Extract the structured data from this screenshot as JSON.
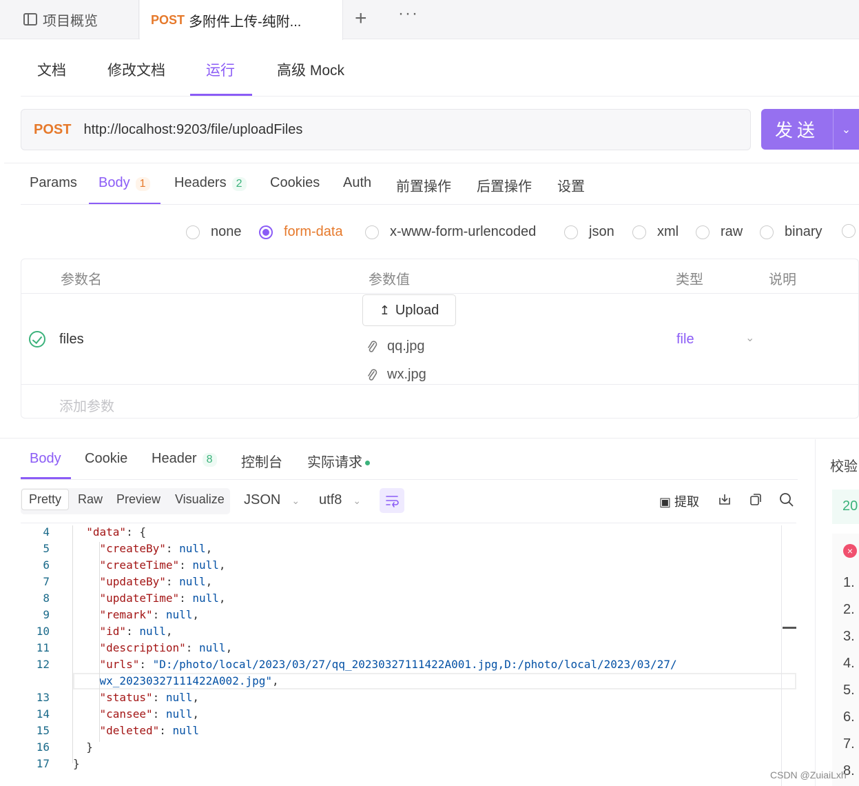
{
  "tabs": {
    "overview": "项目概览",
    "current_method": "POST",
    "current_title": "多附件上传-纯附...",
    "add": "+",
    "more": "···"
  },
  "doc_tabs": [
    "文档",
    "修改文档",
    "运行",
    "高级 Mock"
  ],
  "request": {
    "method": "POST",
    "url": "http://localhost:9203/file/uploadFiles",
    "send_label": "发送"
  },
  "req_tabs": {
    "params": "Params",
    "body": "Body",
    "body_count": "1",
    "headers": "Headers",
    "headers_count": "2",
    "cookies": "Cookies",
    "auth": "Auth",
    "pre": "前置操作",
    "post": "后置操作",
    "settings": "设置"
  },
  "body_types": [
    "none",
    "form-data",
    "x-www-form-urlencoded",
    "json",
    "xml",
    "raw",
    "binary"
  ],
  "body_type_selected": "form-data",
  "params_table": {
    "headers": [
      "参数名",
      "参数值",
      "类型",
      "说明"
    ],
    "row": {
      "name": "files",
      "upload_label": "Upload",
      "files": [
        "qq.jpg",
        "wx.jpg"
      ],
      "type": "file"
    },
    "add_placeholder": "添加参数"
  },
  "response": {
    "tabs": {
      "body": "Body",
      "cookie": "Cookie",
      "header": "Header",
      "header_count": "8",
      "console": "控制台",
      "actual": "实际请求"
    },
    "view_modes": [
      "Pretty",
      "Raw",
      "Preview",
      "Visualize"
    ],
    "format": "JSON",
    "encoding": "utf8",
    "extract_label": "提取"
  },
  "code_lines": [
    {
      "n": "4",
      "t": "  \"data\": {"
    },
    {
      "n": "5",
      "t": "    \"createBy\": null,"
    },
    {
      "n": "6",
      "t": "    \"createTime\": null,"
    },
    {
      "n": "7",
      "t": "    \"updateBy\": null,"
    },
    {
      "n": "8",
      "t": "    \"updateTime\": null,"
    },
    {
      "n": "9",
      "t": "    \"remark\": null,"
    },
    {
      "n": "10",
      "t": "    \"id\": null,"
    },
    {
      "n": "11",
      "t": "    \"description\": null,"
    },
    {
      "n": "12",
      "t": "    \"urls\": \"D:/photo/local/2023/03/27/qq_20230327111422A001.jpg,D:/photo/local/2023/03/27/"
    },
    {
      "n": "",
      "t": "    wx_20230327111422A002.jpg\","
    },
    {
      "n": "13",
      "t": "    \"status\": null,"
    },
    {
      "n": "14",
      "t": "    \"cansee\": null,"
    },
    {
      "n": "15",
      "t": "    \"deleted\": null"
    },
    {
      "n": "16",
      "t": "  }"
    },
    {
      "n": "17",
      "t": "}"
    }
  ],
  "right_panel": {
    "title": "校验",
    "status": "20",
    "items": [
      "1.",
      "2.",
      "3.",
      "4.",
      "5.",
      "6.",
      "7.",
      "8."
    ]
  },
  "watermark": "CSDN @ZuiaiLxh"
}
